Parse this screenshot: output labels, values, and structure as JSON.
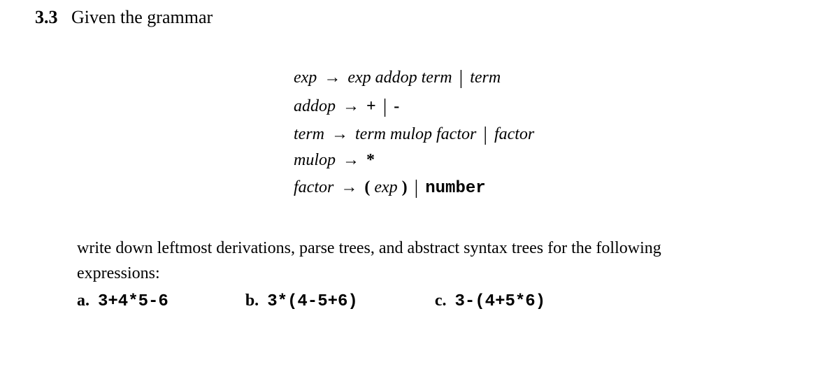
{
  "section": {
    "number": "3.3",
    "title": "Given the grammar"
  },
  "grammar": {
    "lines": [
      {
        "lhs": "exp",
        "rhs_parts": [
          {
            "type": "nt",
            "text": "exp addop term"
          },
          {
            "type": "pipe"
          },
          {
            "type": "nt",
            "text": "term"
          }
        ]
      },
      {
        "lhs": "addop",
        "rhs_parts": [
          {
            "type": "term",
            "text": "+"
          },
          {
            "type": "pipe"
          },
          {
            "type": "term",
            "text": "-"
          }
        ]
      },
      {
        "lhs": "term",
        "rhs_parts": [
          {
            "type": "nt",
            "text": "term mulop factor"
          },
          {
            "type": "pipe"
          },
          {
            "type": "nt",
            "text": "factor"
          }
        ]
      },
      {
        "lhs": "mulop",
        "rhs_parts": [
          {
            "type": "term",
            "text": "*"
          }
        ]
      },
      {
        "lhs": "factor",
        "rhs_parts": [
          {
            "type": "term",
            "text": "("
          },
          {
            "type": "nt",
            "text": " exp "
          },
          {
            "type": "term",
            "text": ")"
          },
          {
            "type": "pipe"
          },
          {
            "type": "termbold",
            "text": "number"
          }
        ]
      }
    ],
    "arrow": "→"
  },
  "instruction": {
    "line1": "write down leftmost derivations, parse trees, and abstract syntax trees for the following",
    "line2": "expressions:"
  },
  "expressions": [
    {
      "letter": "a.",
      "code": "3+4*5-6"
    },
    {
      "letter": "b.",
      "code": "3*(4-5+6)"
    },
    {
      "letter": "c.",
      "code": "3-(4+5*6)"
    }
  ]
}
